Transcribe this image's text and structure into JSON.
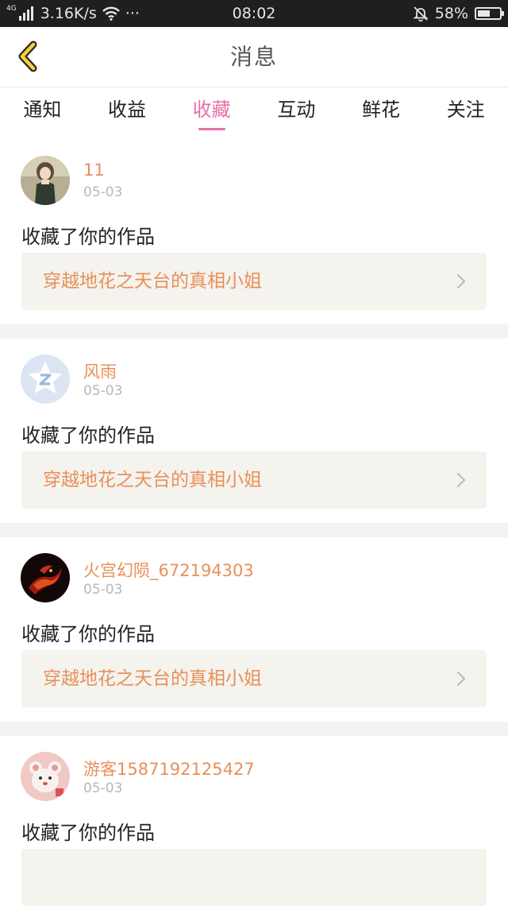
{
  "status_bar": {
    "net_tag": "4G",
    "speed": "3.16K/s",
    "more": "···",
    "time": "08:02",
    "battery": "58%",
    "battery_level": 0.58
  },
  "header": {
    "title": "消息",
    "back_icon": "chevron-left-icon"
  },
  "tabs": [
    {
      "label": "通知",
      "active": false
    },
    {
      "label": "收益",
      "active": false
    },
    {
      "label": "收藏",
      "active": true
    },
    {
      "label": "互动",
      "active": false
    },
    {
      "label": "鲜花",
      "active": false
    },
    {
      "label": "关注",
      "active": false
    }
  ],
  "colors": {
    "accent": "#e86fa8",
    "name": "#e8905a",
    "link_bg": "#f4f3ee"
  },
  "messages": [
    {
      "username": "11",
      "date": "05-03",
      "action": "收藏了你的作品",
      "work_title": "穿越地花之天台的真相小姐",
      "avatar": "girl-photo-avatar"
    },
    {
      "username": "风雨",
      "date": "05-03",
      "action": "收藏了你的作品",
      "work_title": "穿越地花之天台的真相小姐",
      "avatar": "qq-default-avatar"
    },
    {
      "username": "火宫幻陨_672194303",
      "date": "05-03",
      "action": "收藏了你的作品",
      "work_title": "穿越地花之天台的真相小姐",
      "avatar": "fire-dragon-avatar"
    },
    {
      "username": "游客1587192125427",
      "date": "05-03",
      "action": "收藏了你的作品",
      "work_title": "",
      "avatar": "cartoon-mouse-avatar"
    }
  ]
}
